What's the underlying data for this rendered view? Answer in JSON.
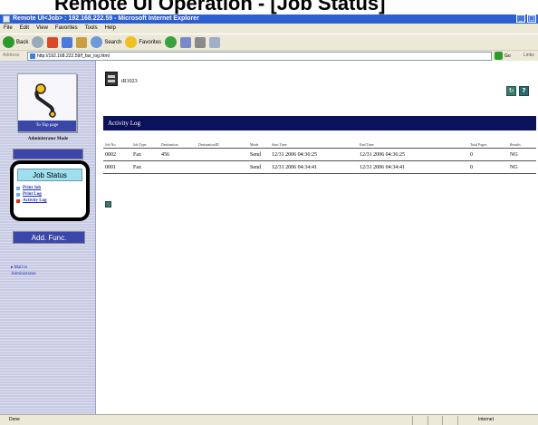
{
  "caption": {
    "text": "Remote UI Operation - [Job Status]"
  },
  "window": {
    "title": "Remote UI<Job> : 192.168.222.59 - Microsoft Internet Explorer",
    "buttons": {
      "minimize": "_",
      "close": "×"
    }
  },
  "menu": [
    "File",
    "Edit",
    "View",
    "Favorites",
    "Tools",
    "Help"
  ],
  "toolbar": {
    "back": "Back",
    "search": "Search",
    "favorites": "Favorites"
  },
  "address": {
    "label": "Address",
    "url": "http://192.168.222.59/f_fax_log.html",
    "go": "Go",
    "links": "Links"
  },
  "sidebar": {
    "top_page": "To Top page",
    "admin_mode": "Administrator Mode",
    "job_status": "Job Status",
    "items": [
      {
        "label": "Print Job",
        "active": false
      },
      {
        "label": "Print Log",
        "active": false
      },
      {
        "label": "Activity Log",
        "active": true
      }
    ],
    "add_func": "Add. Func.",
    "mail_to": "Mail to",
    "administrator": "Administrator"
  },
  "main": {
    "device_name": "iR1023",
    "refresh_icon": "↻",
    "help_icon": "?",
    "section_title": "Activity Log",
    "table": {
      "headers": [
        "Job No.",
        "Job Type",
        "Destination",
        "DestinationID",
        "Mode",
        "Start Time",
        "End Time",
        "Total Pages",
        "Results"
      ],
      "rows": [
        [
          "0002",
          "Fax",
          "456",
          "",
          "Send",
          "12/31 2006 04:36:25",
          "12/31 2006 04:36:25",
          "0",
          "NG"
        ],
        [
          "0001",
          "Fax",
          "",
          "",
          "Send",
          "12/31 2006 04:34:41",
          "12/31 2006 04:34:41",
          "0",
          "NG"
        ]
      ]
    }
  },
  "status": {
    "text": "Done",
    "zone": "Internet"
  },
  "colors": {
    "nav_blue": "#3b47a8",
    "header_navy": "#0b1259",
    "job_status_bg": "#9fe0f0",
    "active_bullet": "#e03010"
  }
}
